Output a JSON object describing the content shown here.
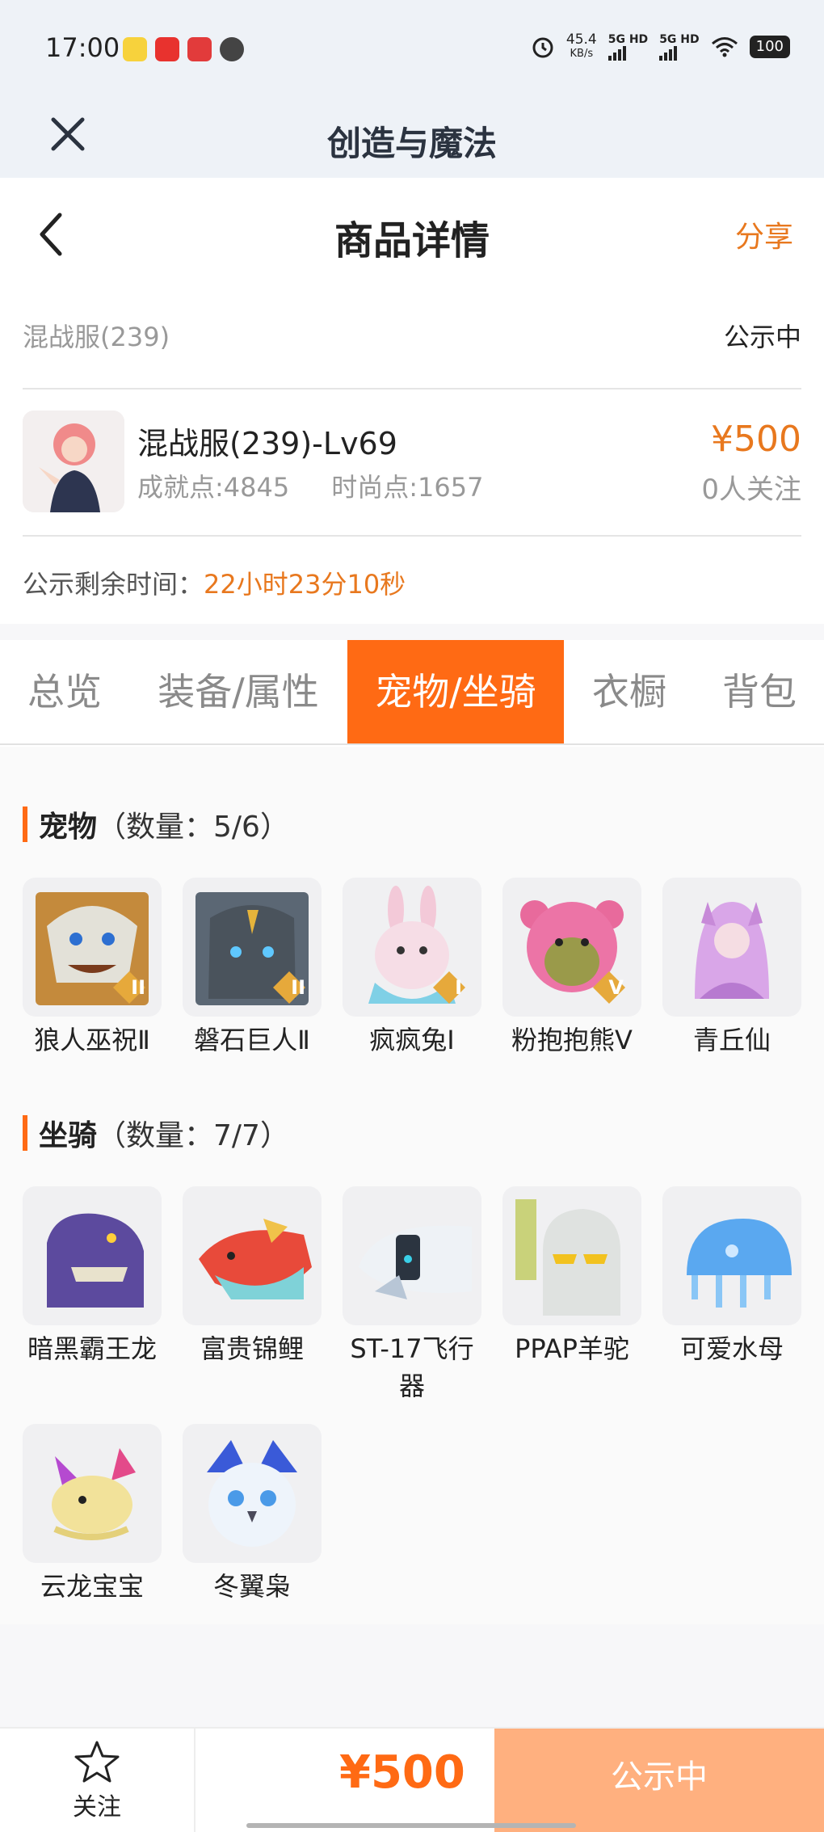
{
  "status_bar": {
    "time": "17:00",
    "speed_value": "45.4",
    "speed_unit": "KB/s",
    "net1": "5G HD",
    "net2": "5G HD",
    "battery": "100"
  },
  "app_header": {
    "title": "创造与魔法"
  },
  "nav": {
    "title": "商品详情",
    "share": "分享"
  },
  "server": {
    "name": "混战服(239)",
    "status": "公示中"
  },
  "product": {
    "name": "混战服(239)-Lv69",
    "achievement": "成就点:4845",
    "fashion": "时尚点:1657",
    "price": "¥500",
    "followers": "0人关注"
  },
  "remaining": {
    "label": "公示剩余时间：",
    "value": "22小时23分10秒"
  },
  "tabs": [
    {
      "label": "总览"
    },
    {
      "label": "装备/属性"
    },
    {
      "label": "宠物/坐骑"
    },
    {
      "label": "衣橱"
    },
    {
      "label": "背包"
    }
  ],
  "pets": {
    "title": "宠物",
    "count": "（数量：5/6）",
    "items": [
      {
        "name": "狼人巫祝Ⅱ",
        "badge": "II"
      },
      {
        "name": "磐石巨人Ⅱ",
        "badge": "II"
      },
      {
        "name": "疯疯兔I",
        "badge": "I"
      },
      {
        "name": "粉抱抱熊Ⅴ",
        "badge": "V"
      },
      {
        "name": "青丘仙",
        "badge": ""
      }
    ]
  },
  "mounts": {
    "title": "坐骑",
    "count": "（数量：7/7）",
    "items": [
      {
        "name": "暗黑霸王龙"
      },
      {
        "name": "富贵锦鲤"
      },
      {
        "name": "ST-17飞行器"
      },
      {
        "name": "PPAP羊驼"
      },
      {
        "name": "可爱水母"
      },
      {
        "name": "云龙宝宝"
      },
      {
        "name": "冬翼枭"
      }
    ]
  },
  "bottom": {
    "follow": "关注",
    "price": "¥500",
    "status": "公示中"
  },
  "colors": {
    "accent": "#ff6a14",
    "price": "#e8781e",
    "status_button": "#ffb07f"
  }
}
